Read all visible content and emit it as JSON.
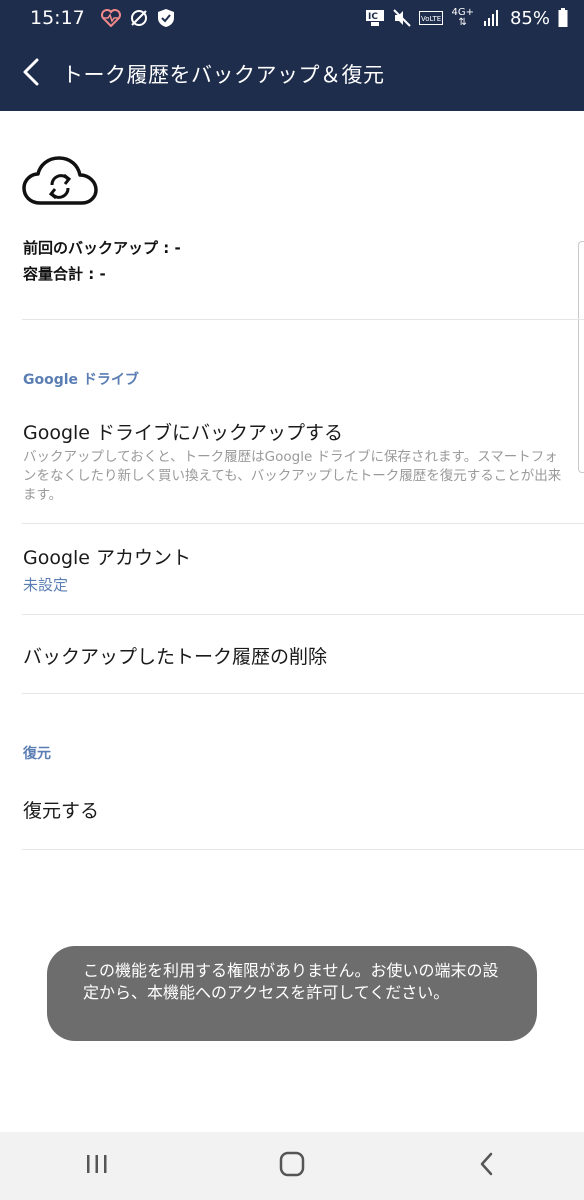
{
  "status_bar": {
    "time": "15:17",
    "battery_percent": "85%",
    "network_label": "4G+",
    "icons": [
      "heart-monitor-icon",
      "no-sync-icon",
      "shield-check-icon",
      "ic-card-icon",
      "key-icon",
      "mute-icon",
      "volte-icon",
      "signal-icon",
      "battery-icon"
    ]
  },
  "header": {
    "title": "トーク履歴をバックアップ＆復元",
    "back_icon": "back-arrow-icon"
  },
  "summary": {
    "icon": "cloud-sync-icon",
    "last_backup_label": "前回のバックアップ :",
    "last_backup_value": "-",
    "total_size_label": "容量合計 :",
    "total_size_value": "-"
  },
  "sections": {
    "google_drive": {
      "header": "Google ドライブ",
      "backup": {
        "title": "Google ドライブにバックアップする",
        "description": "バックアップしておくと、トーク履歴はGoogle ドライブに保存されます。スマートフォンをなくしたり新しく買い換えても、バックアップしたトーク履歴を復元することが出来ます。"
      },
      "account": {
        "title": "Google アカウント",
        "value": "未設定"
      },
      "delete": {
        "title": "バックアップしたトーク履歴の削除"
      }
    },
    "restore": {
      "header": "復元",
      "restore_item": {
        "title": "復元する"
      }
    }
  },
  "toast": {
    "message": "この機能を利用する権限がありません。お使いの端末の設定から、本機能へのアクセスを許可してください。"
  },
  "nav_bar": {
    "buttons": [
      "recent-apps-icon",
      "home-icon",
      "back-icon"
    ]
  },
  "colors": {
    "header_bg": "#1f2d4c",
    "accent_blue": "#5a7eb3",
    "toast_bg": "#6d6d6d",
    "nav_bg": "#f2f2f2"
  }
}
